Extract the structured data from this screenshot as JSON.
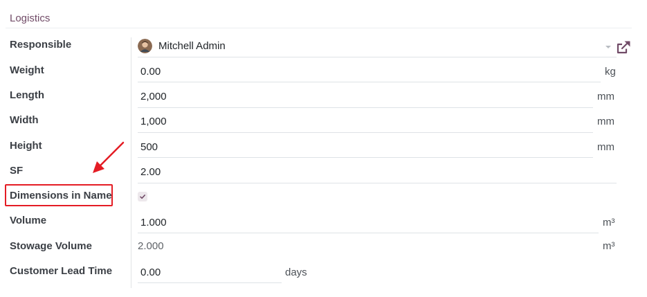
{
  "section": {
    "title": "Logistics"
  },
  "fields": {
    "responsible": {
      "label": "Responsible",
      "value": "Mitchell Admin"
    },
    "weight": {
      "label": "Weight",
      "value": "0.00",
      "unit": "kg"
    },
    "length": {
      "label": "Length",
      "value": "2,000",
      "unit": "mm"
    },
    "width": {
      "label": "Width",
      "value": "1,000",
      "unit": "mm"
    },
    "height": {
      "label": "Height",
      "value": "500",
      "unit": "mm"
    },
    "sf": {
      "label": "SF",
      "value": "2.00"
    },
    "dimensions_in_name": {
      "label": "Dimensions in Name",
      "checked": true
    },
    "volume": {
      "label": "Volume",
      "value": "1.000",
      "unit": "m³"
    },
    "stowage_volume": {
      "label": "Stowage Volume",
      "value": "2.000",
      "unit": "m³"
    },
    "customer_lead_time": {
      "label": "Customer Lead Time",
      "value": "0.00",
      "unit": "days"
    }
  },
  "icons": {
    "avatar": "user-avatar",
    "dropdown": "caret-down-icon",
    "external": "external-link-icon",
    "checkbox": "check-icon",
    "annotation": "red-arrow-icon"
  },
  "colors": {
    "accent": "#714B67",
    "annotation_red": "#e41c24",
    "label": "#3b3f45",
    "divider": "#dee2e6"
  }
}
